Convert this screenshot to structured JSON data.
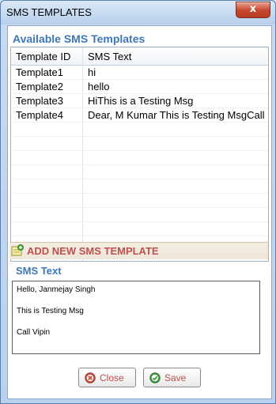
{
  "window": {
    "title": "SMS TEMPLATES",
    "close_glyph": "x"
  },
  "available": {
    "heading": "Available SMS Templates",
    "columns": [
      "Template ID",
      "SMS Text"
    ],
    "rows": [
      {
        "id": "Template1",
        "text": "hi"
      },
      {
        "id": "Template2",
        "text": "hello"
      },
      {
        "id": "Template3",
        "text": "HiThis is a Testing Msg"
      },
      {
        "id": "Template4",
        "text": "Dear, M Kumar This is Testing MsgCall P"
      }
    ]
  },
  "add_template": {
    "label": "ADD NEW SMS TEMPLATE",
    "icon": "note-add-icon"
  },
  "sms": {
    "heading": "SMS Text",
    "value": "Hello, Janmejay Singh\n\nThis is Testing Msg\n\nCall Vipin"
  },
  "buttons": {
    "close_label": "Close",
    "save_label": "Save",
    "close_icon": "cancel-circle-icon",
    "save_icon": "check-circle-icon"
  },
  "colors": {
    "accent_blue": "#3d77b6",
    "accent_red": "#c0504d",
    "title_close": "#c6452c"
  }
}
